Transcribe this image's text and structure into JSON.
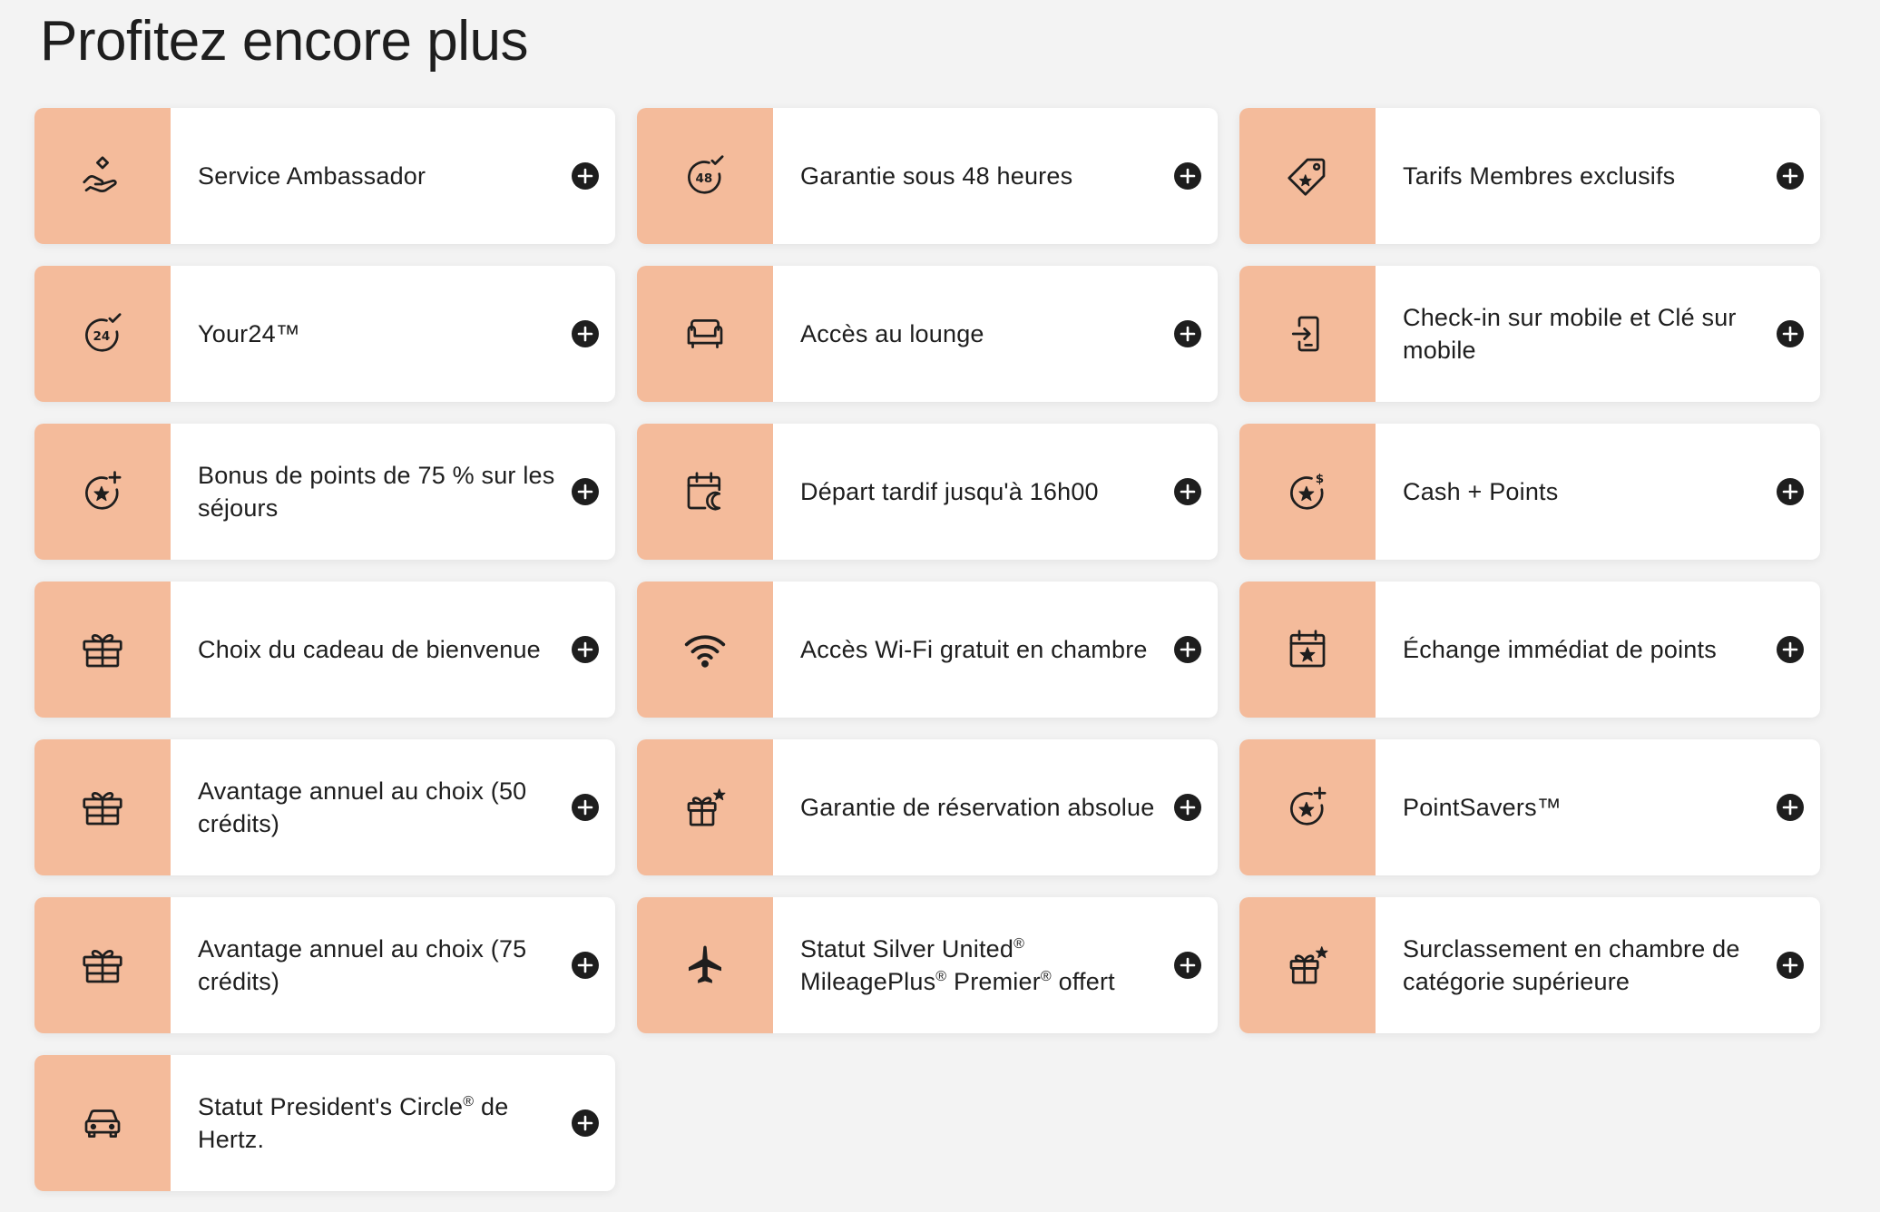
{
  "page": {
    "title": "Profitez encore plus"
  },
  "colors": {
    "icon_background": "#f4bb9b",
    "card_background": "#ffffff",
    "page_background": "#f3f3f3",
    "text": "#1e1e1e"
  },
  "benefits": [
    {
      "label": "Service Ambassador",
      "icon": "hand-diamond-icon"
    },
    {
      "label": "Garantie sous 48 heures",
      "icon": "clock-48-check-icon"
    },
    {
      "label": "Tarifs Membres exclusifs",
      "icon": "tag-icon"
    },
    {
      "label": "Your24™",
      "icon": "clock-24-check-icon"
    },
    {
      "label": "Accès au lounge",
      "icon": "sofa-icon"
    },
    {
      "label": "Check-in sur mobile et Clé sur mobile",
      "icon": "mobile-checkin-icon"
    },
    {
      "label": "Bonus de points de 75 % sur les séjours",
      "icon": "star-plus-icon"
    },
    {
      "label": "Départ tardif jusqu'à 16h00",
      "icon": "calendar-moon-icon"
    },
    {
      "label": "Cash + Points",
      "icon": "star-dollar-icon"
    },
    {
      "label": "Choix du cadeau de bienvenue",
      "icon": "gift-icon"
    },
    {
      "label": "Accès Wi-Fi gratuit en chambre",
      "icon": "wifi-icon"
    },
    {
      "label": "Échange immédiat de points",
      "icon": "calendar-star-icon"
    },
    {
      "label": "Avantage annuel au choix (50 crédits)",
      "icon": "gift-icon"
    },
    {
      "label": "Garantie de réservation absolue",
      "icon": "gift-star-icon"
    },
    {
      "label": "PointSavers™",
      "icon": "star-plus-icon"
    },
    {
      "label": "Avantage annuel au choix (75 crédits)",
      "icon": "gift-icon"
    },
    {
      "label_parts": [
        "Statut Silver United",
        "®",
        " MileagePlus",
        "®",
        " Premier",
        "®",
        " offert"
      ],
      "icon": "airplane-icon"
    },
    {
      "label": "Surclassement en chambre de catégorie supérieure",
      "icon": "gift-star-icon"
    },
    {
      "label_parts": [
        "Statut President's Circle",
        "®",
        " de Hertz."
      ],
      "icon": "car-icon"
    }
  ]
}
